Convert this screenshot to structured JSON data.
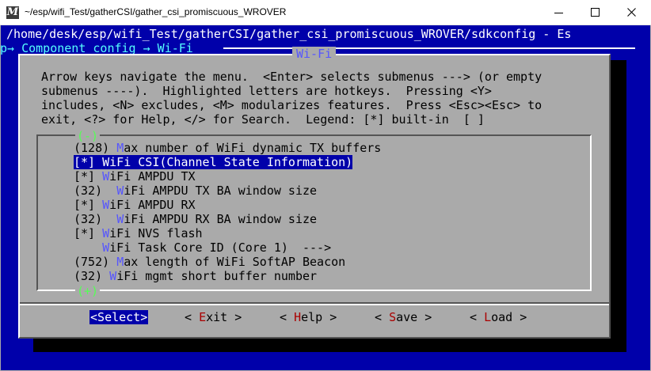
{
  "window": {
    "title": "~/esp/wifi_Test/gatherCSI/gather_csi_promiscuous_WROVER",
    "app_icon": "mintty-icon",
    "app_icon_glyph": "M"
  },
  "terminal": {
    "path": "/home/desk/esp/wifi_Test/gatherCSI/gather_csi_promiscuous_WROVER/sdkconfig - Es",
    "breadcrumb": "p→ Component config → Wi-Fi ",
    "background_color": "#0000aa"
  },
  "dialog": {
    "title": "Wi-Fi",
    "help_lines": [
      "Arrow keys navigate the menu.  <Enter> selects submenus ---> (or empty",
      "submenus ----).  Highlighted letters are hotkeys.  Pressing <Y>",
      "includes, <N> excludes, <M> modularizes features.  Press <Esc><Esc> to",
      "exit, <?> for Help, </> for Search.  Legend: [*] built-in  [ ]"
    ],
    "more_up": "(-)",
    "more_down": "(+)",
    "items": [
      {
        "pre": "(128) ",
        "hk": "M",
        "post": "ax number of WiFi dynamic TX buffers"
      },
      {
        "pre": "[*] ",
        "hk": "W",
        "post": "iFi CSI(Channel State Information)"
      },
      {
        "pre": "[*] ",
        "hk": "W",
        "post": "iFi AMPDU TX"
      },
      {
        "pre": "(32)  ",
        "hk": "W",
        "post": "iFi AMPDU TX BA window size"
      },
      {
        "pre": "[*] ",
        "hk": "W",
        "post": "iFi AMPDU RX"
      },
      {
        "pre": "(32)  ",
        "hk": "W",
        "post": "iFi AMPDU RX BA window size"
      },
      {
        "pre": "[*] ",
        "hk": "W",
        "post": "iFi NVS flash"
      },
      {
        "pre": "    ",
        "hk": "W",
        "post": "iFi Task Core ID (Core 1)  --->"
      },
      {
        "pre": "(752) ",
        "hk": "M",
        "post": "ax length of WiFi SoftAP Beacon"
      },
      {
        "pre": "(32) ",
        "hk": "W",
        "post": "iFi mgmt short buffer number"
      }
    ],
    "selected_index": 1,
    "buttons": [
      {
        "pre": "<",
        "hk": "S",
        "post": "elect>"
      },
      {
        "pre": "< ",
        "hk": "E",
        "post": "xit >"
      },
      {
        "pre": "< ",
        "hk": "H",
        "post": "elp >"
      },
      {
        "pre": "< ",
        "hk": "S",
        "post": "ave >"
      },
      {
        "pre": "< ",
        "hk": "L",
        "post": "oad >"
      }
    ],
    "active_button": 0
  },
  "colors": {
    "menu_bg": "#aaaaaa",
    "highlight_bg": "#0000aa",
    "hotkey": "#5555ff",
    "button_hotkey": "#aa0000",
    "more_indicator": "#55ff55"
  }
}
